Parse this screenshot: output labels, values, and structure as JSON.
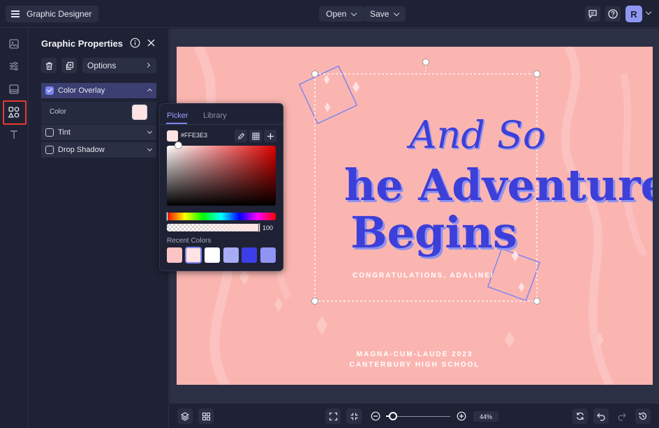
{
  "app": {
    "title": "Graphic Designer"
  },
  "topbar": {
    "open_label": "Open",
    "save_label": "Save",
    "avatar_initial": "R"
  },
  "panel": {
    "title": "Graphic Properties",
    "options_label": "Options",
    "sections": {
      "color_overlay": {
        "label": "Color Overlay",
        "checked": true,
        "expanded": true
      },
      "color_label": "Color",
      "tint": {
        "label": "Tint",
        "checked": false
      },
      "drop_shadow": {
        "label": "Drop Shadow",
        "checked": false
      }
    },
    "overlay_color": "#ffe3e3"
  },
  "picker": {
    "tab_picker": "Picker",
    "tab_library": "Library",
    "hex_value": "#FFE3E3",
    "alpha_value": "100",
    "recent_label": "Recent Colors",
    "recent_colors": [
      "#fcc4c4",
      "#ffe3e3",
      "#ffffff",
      "#a8abf5",
      "#3c3fe8",
      "#8f93f3"
    ]
  },
  "design": {
    "line1": "And So",
    "line2": "he Adventure",
    "line3": "Begins",
    "congrats": "CONGRATULATIONS, ADALINE!",
    "footer1": "MAGNA-CUM-LAUDE 2023",
    "footer2": "CANTERBURY HIGH SCHOOL",
    "background": "#fbb5b1",
    "accent": "#3c3fd8"
  },
  "bottombar": {
    "zoom": "44%"
  },
  "colors": {
    "bg": "#1f2235",
    "canvas": "#2c3045",
    "highlight": "#e8392e"
  }
}
